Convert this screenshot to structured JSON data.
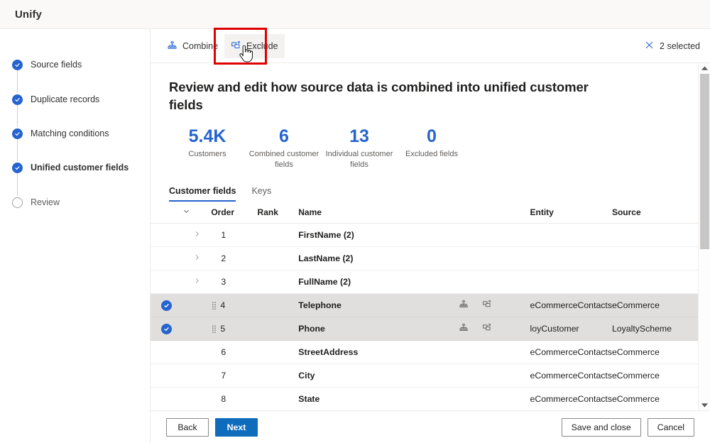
{
  "app": {
    "title": "Unify"
  },
  "rail": {
    "steps": [
      {
        "label": "Source fields",
        "state": "done"
      },
      {
        "label": "Duplicate records",
        "state": "done"
      },
      {
        "label": "Matching conditions",
        "state": "done"
      },
      {
        "label": "Unified customer fields",
        "state": "current"
      },
      {
        "label": "Review",
        "state": "todo"
      }
    ]
  },
  "commandbar": {
    "combine_label": "Combine",
    "exclude_label": "Exclude",
    "selected_label": "2 selected",
    "close_icon": "close-icon"
  },
  "page": {
    "title": "Review and edit how source data is combined into unified customer fields"
  },
  "kpis": [
    {
      "value": "5.4K",
      "caption": "Customers"
    },
    {
      "value": "6",
      "caption": "Combined customer fields"
    },
    {
      "value": "13",
      "caption": "Individual customer fields"
    },
    {
      "value": "0",
      "caption": "Excluded fields"
    }
  ],
  "tabs": [
    {
      "label": "Customer fields",
      "active": true
    },
    {
      "label": "Keys",
      "active": false
    }
  ],
  "table": {
    "headers": {
      "expand": "",
      "order": "Order",
      "rank": "Rank",
      "name": "Name",
      "entity": "Entity",
      "source": "Source"
    },
    "rows": [
      {
        "selected": false,
        "expandable": true,
        "order": "1",
        "rank": "",
        "name": "FirstName (2)",
        "entity": "",
        "source": ""
      },
      {
        "selected": false,
        "expandable": true,
        "order": "2",
        "rank": "",
        "name": "LastName (2)",
        "entity": "",
        "source": ""
      },
      {
        "selected": false,
        "expandable": true,
        "order": "3",
        "rank": "",
        "name": "FullName (2)",
        "entity": "",
        "source": ""
      },
      {
        "selected": true,
        "expandable": false,
        "order": "4",
        "rank": "",
        "name": "Telephone",
        "entity": "eCommerceContacts",
        "source": "eCommerce"
      },
      {
        "selected": true,
        "expandable": false,
        "order": "5",
        "rank": "",
        "name": "Phone",
        "entity": "loyCustomer",
        "source": "LoyaltyScheme"
      },
      {
        "selected": false,
        "expandable": false,
        "order": "6",
        "rank": "",
        "name": "StreetAddress",
        "entity": "eCommerceContacts",
        "source": "eCommerce"
      },
      {
        "selected": false,
        "expandable": false,
        "order": "7",
        "rank": "",
        "name": "City",
        "entity": "eCommerceContacts",
        "source": "eCommerce"
      },
      {
        "selected": false,
        "expandable": false,
        "order": "8",
        "rank": "",
        "name": "State",
        "entity": "eCommerceContacts",
        "source": "eCommerce"
      }
    ]
  },
  "footer": {
    "back": "Back",
    "next": "Next",
    "save_and_close": "Save and close",
    "cancel": "Cancel"
  },
  "colors": {
    "accent": "#2564cf",
    "primary_button": "#0f6cbd",
    "annotation": "#e00000",
    "selected_row": "#e1dfdd"
  }
}
